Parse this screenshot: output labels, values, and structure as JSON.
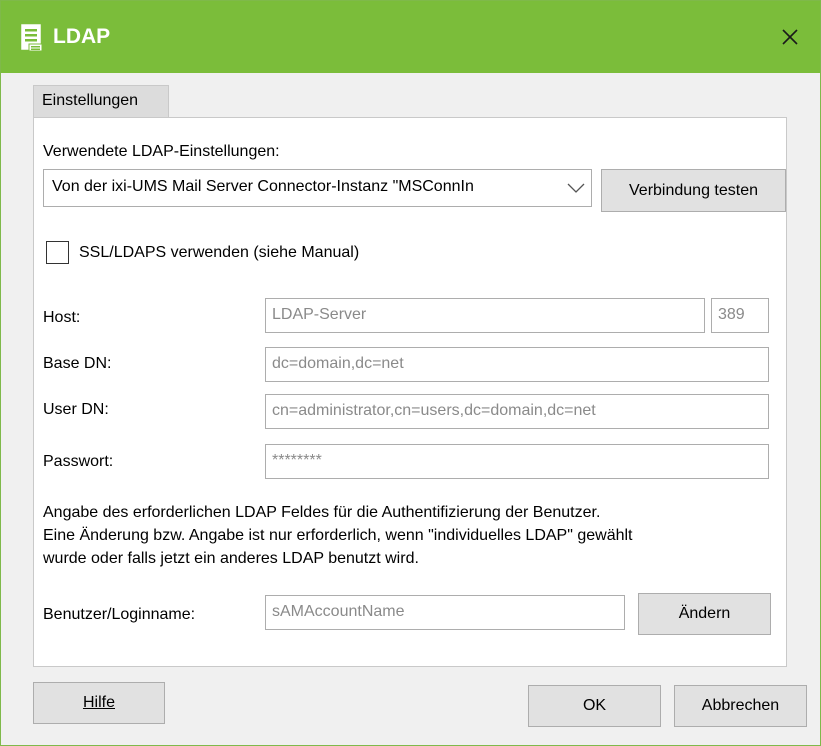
{
  "window": {
    "title": "LDAP"
  },
  "tabs": [
    {
      "label": "Einstellungen"
    }
  ],
  "settings": {
    "used_label": "Verwendete LDAP-Einstellungen:",
    "used_value": "Von der ixi-UMS Mail Server Connector-Instanz \"MSConnIn",
    "test_button": "Verbindung testen",
    "ssl_label": "SSL/LDAPS verwenden (siehe Manual)",
    "ssl_checked": false
  },
  "fields": {
    "host_label": "Host:",
    "host_value": "LDAP-Server",
    "port_value": "389",
    "basedn_label": "Base DN:",
    "basedn_value": "dc=domain,dc=net",
    "userdn_label": "User DN:",
    "userdn_value": "cn=administrator,cn=users,dc=domain,dc=net",
    "password_label": "Passwort:",
    "password_value": "********"
  },
  "info": {
    "line1": "Angabe des erforderlichen LDAP Feldes für die Authentifizierung der Benutzer.",
    "line2": "Eine Änderung bzw. Angabe ist nur erforderlich, wenn \"individuelles LDAP\" gewählt",
    "line3": "wurde oder falls jetzt ein anderes LDAP benutzt wird."
  },
  "login": {
    "label": "Benutzer/Loginname:",
    "value": "sAMAccountName",
    "change_button": "Ändern"
  },
  "footer": {
    "help_button": "Hilfe",
    "ok_button": "OK",
    "cancel_button": "Abbrechen"
  },
  "colors": {
    "titlebar": "#7bbd3a",
    "button": "#e1e1e1",
    "border": "#adadad"
  }
}
